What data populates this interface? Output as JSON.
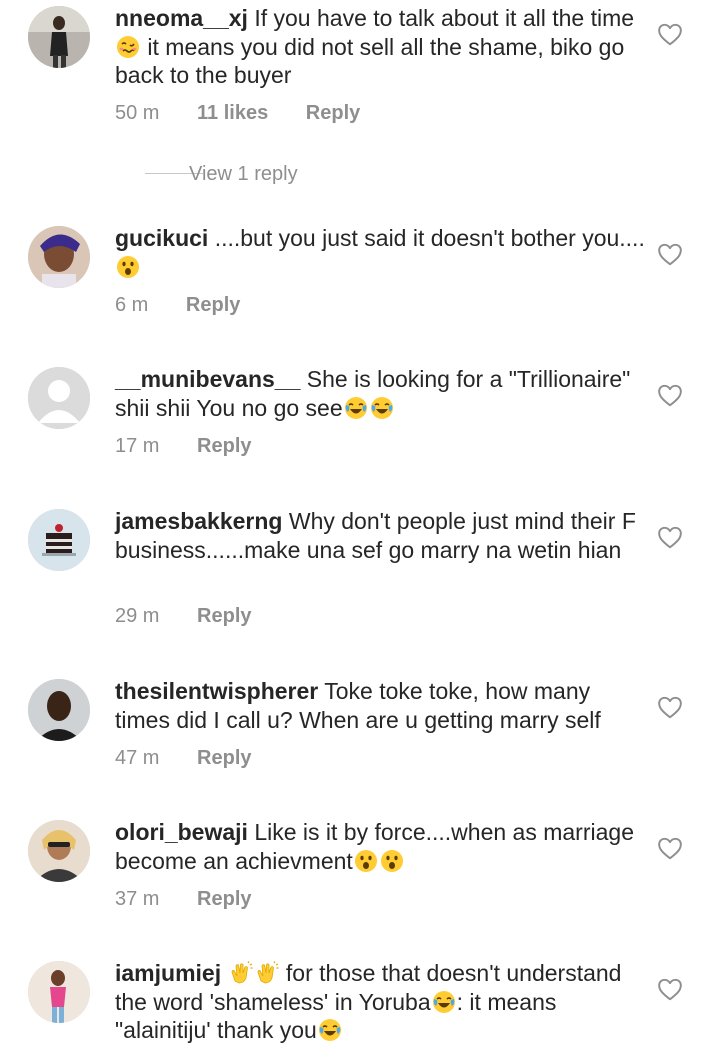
{
  "comments": [
    {
      "username": "nneoma__xj",
      "text": [
        "If you have to talk about it all the time",
        " it means you did not sell all the shame, biko go back to the buyer"
      ],
      "emojis": [
        "woozy-face"
      ],
      "time": "50 m",
      "likes": "11 likes",
      "reply": "Reply"
    },
    {
      "username": "gucikuci",
      "text": [
        "....but you just said it doesn't bother you...."
      ],
      "emojis": [
        "astonished-face"
      ],
      "time": "6 m",
      "reply": "Reply"
    },
    {
      "username": "__munibevans__",
      "text": [
        "She is looking for a \"Trillionaire\" shii shii You no go see"
      ],
      "emojis": [
        "tears-of-joy-face",
        "tears-of-joy-face"
      ],
      "time": "17 m",
      "reply": "Reply"
    },
    {
      "username": "jamesbakkerng",
      "text": [
        "Why don't people just mind their F business......make una sef go marry na wetin hian"
      ],
      "time": "29 m",
      "reply": "Reply"
    },
    {
      "username": "thesilentwispherer",
      "text": [
        "Toke toke toke, how many times did I call u? When are u getting marry self"
      ],
      "time": "47 m",
      "reply": "Reply"
    },
    {
      "username": "olori_bewaji",
      "text": [
        "Like is it by force....when as marriage become an achievment"
      ],
      "emojis": [
        "astonished-face",
        "astonished-face"
      ],
      "time": "37 m",
      "reply": "Reply"
    },
    {
      "username": "iamjumiej",
      "text": [
        " for those that doesn't understand the word 'shameless' in Yoruba",
        ": it means \"alainitiju' thank you"
      ],
      "emojis": [
        "clapping-hands",
        "clapping-hands",
        "tears-of-joy-face",
        "tears-of-joy-face"
      ]
    }
  ],
  "view_replies": "View 1 reply",
  "colors": {
    "text": "#262626",
    "meta": "#8e8e8e",
    "divider": "#c7c7c7",
    "emoji_yellow": "#FFCC33"
  }
}
